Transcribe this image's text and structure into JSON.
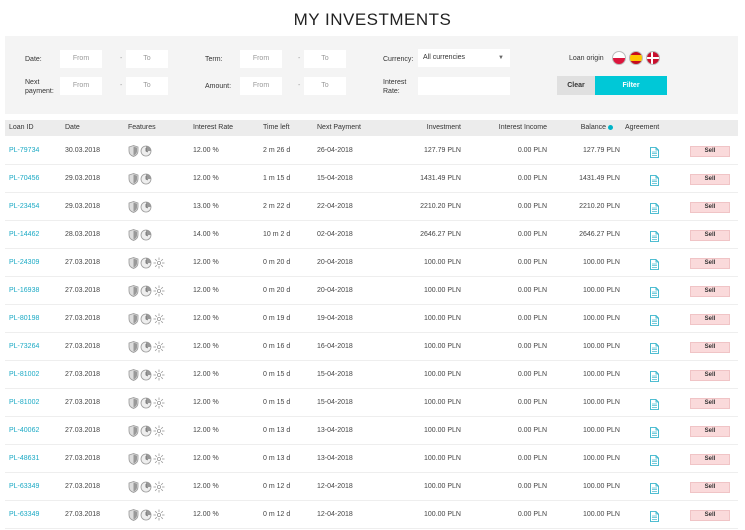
{
  "page": {
    "title": "MY INVESTMENTS"
  },
  "filters": {
    "date_label": "Date:",
    "next_payment_label": "Next\npayment:",
    "term_label": "Term:",
    "amount_label": "Amount:",
    "currency_label": "Currency:",
    "interest_rate_label": "Interest\nRate:",
    "loan_origin_label": "Loan origin",
    "from_placeholder": "From",
    "to_placeholder": "To",
    "dash": "-",
    "currency_value": "All currencies",
    "clear_label": "Clear",
    "filter_label": "Filter",
    "flags": [
      "poland-flag",
      "spain-flag",
      "denmark-flag"
    ]
  },
  "table": {
    "columns": [
      "Loan ID",
      "Date",
      "Features",
      "Interest Rate",
      "Time left",
      "Next Payment",
      "Investment",
      "Interest Income",
      "Balance",
      "Agreement"
    ],
    "sell_label": "Sell",
    "rows": [
      {
        "id": "PL-79734",
        "date": "30.03.2018",
        "features": [
          "shield-icon",
          "clock-icon"
        ],
        "rate": "12.00 %",
        "time_left": "2 m 26 d",
        "next_payment": "26-04-2018",
        "investment": "127.79 PLN",
        "income": "0.00 PLN",
        "balance": "127.79 PLN"
      },
      {
        "id": "PL-70456",
        "date": "29.03.2018",
        "features": [
          "shield-icon",
          "clock-icon"
        ],
        "rate": "12.00 %",
        "time_left": "1 m 15 d",
        "next_payment": "15-04-2018",
        "investment": "1431.49 PLN",
        "income": "0.00 PLN",
        "balance": "1431.49 PLN"
      },
      {
        "id": "PL-23454",
        "date": "29.03.2018",
        "features": [
          "shield-icon",
          "clock-icon"
        ],
        "rate": "13.00 %",
        "time_left": "2 m 22 d",
        "next_payment": "22-04-2018",
        "investment": "2210.20 PLN",
        "income": "0.00 PLN",
        "balance": "2210.20 PLN"
      },
      {
        "id": "PL-14462",
        "date": "28.03.2018",
        "features": [
          "shield-icon",
          "clock-icon"
        ],
        "rate": "14.00 %",
        "time_left": "10 m 2 d",
        "next_payment": "02-04-2018",
        "investment": "2646.27 PLN",
        "income": "0.00 PLN",
        "balance": "2646.27 PLN"
      },
      {
        "id": "PL-24309",
        "date": "27.03.2018",
        "features": [
          "shield-icon",
          "clock-icon",
          "sun-icon"
        ],
        "rate": "12.00 %",
        "time_left": "0 m 20 d",
        "next_payment": "20-04-2018",
        "investment": "100.00 PLN",
        "income": "0.00 PLN",
        "balance": "100.00 PLN"
      },
      {
        "id": "PL-16938",
        "date": "27.03.2018",
        "features": [
          "shield-icon",
          "clock-icon",
          "sun-icon"
        ],
        "rate": "12.00 %",
        "time_left": "0 m 20 d",
        "next_payment": "20-04-2018",
        "investment": "100.00 PLN",
        "income": "0.00 PLN",
        "balance": "100.00 PLN"
      },
      {
        "id": "PL-80198",
        "date": "27.03.2018",
        "features": [
          "shield-icon",
          "clock-icon",
          "sun-icon"
        ],
        "rate": "12.00 %",
        "time_left": "0 m 19 d",
        "next_payment": "19-04-2018",
        "investment": "100.00 PLN",
        "income": "0.00 PLN",
        "balance": "100.00 PLN"
      },
      {
        "id": "PL-73264",
        "date": "27.03.2018",
        "features": [
          "shield-icon",
          "clock-icon",
          "sun-icon"
        ],
        "rate": "12.00 %",
        "time_left": "0 m 16 d",
        "next_payment": "16-04-2018",
        "investment": "100.00 PLN",
        "income": "0.00 PLN",
        "balance": "100.00 PLN"
      },
      {
        "id": "PL-81002",
        "date": "27.03.2018",
        "features": [
          "shield-icon",
          "clock-icon",
          "sun-icon"
        ],
        "rate": "12.00 %",
        "time_left": "0 m 15 d",
        "next_payment": "15-04-2018",
        "investment": "100.00 PLN",
        "income": "0.00 PLN",
        "balance": "100.00 PLN"
      },
      {
        "id": "PL-81002",
        "date": "27.03.2018",
        "features": [
          "shield-icon",
          "clock-icon",
          "sun-icon"
        ],
        "rate": "12.00 %",
        "time_left": "0 m 15 d",
        "next_payment": "15-04-2018",
        "investment": "100.00 PLN",
        "income": "0.00 PLN",
        "balance": "100.00 PLN"
      },
      {
        "id": "PL-40062",
        "date": "27.03.2018",
        "features": [
          "shield-icon",
          "clock-icon",
          "sun-icon"
        ],
        "rate": "12.00 %",
        "time_left": "0 m 13 d",
        "next_payment": "13-04-2018",
        "investment": "100.00 PLN",
        "income": "0.00 PLN",
        "balance": "100.00 PLN"
      },
      {
        "id": "PL-48631",
        "date": "27.03.2018",
        "features": [
          "shield-icon",
          "clock-icon",
          "sun-icon"
        ],
        "rate": "12.00 %",
        "time_left": "0 m 13 d",
        "next_payment": "13-04-2018",
        "investment": "100.00 PLN",
        "income": "0.00 PLN",
        "balance": "100.00 PLN"
      },
      {
        "id": "PL-63349",
        "date": "27.03.2018",
        "features": [
          "shield-icon",
          "clock-icon",
          "sun-icon"
        ],
        "rate": "12.00 %",
        "time_left": "0 m 12 d",
        "next_payment": "12-04-2018",
        "investment": "100.00 PLN",
        "income": "0.00 PLN",
        "balance": "100.00 PLN"
      },
      {
        "id": "PL-63349",
        "date": "27.03.2018",
        "features": [
          "shield-icon",
          "clock-icon",
          "sun-icon"
        ],
        "rate": "12.00 %",
        "time_left": "0 m 12 d",
        "next_payment": "12-04-2018",
        "investment": "100.00 PLN",
        "income": "0.00 PLN",
        "balance": "100.00 PLN"
      }
    ]
  },
  "colors": {
    "accent": "#00c8d7",
    "link": "#1aa9c4",
    "sell_bg": "#fadadb",
    "panel_bg": "#f4f4f4",
    "header_bg": "#ececec"
  }
}
